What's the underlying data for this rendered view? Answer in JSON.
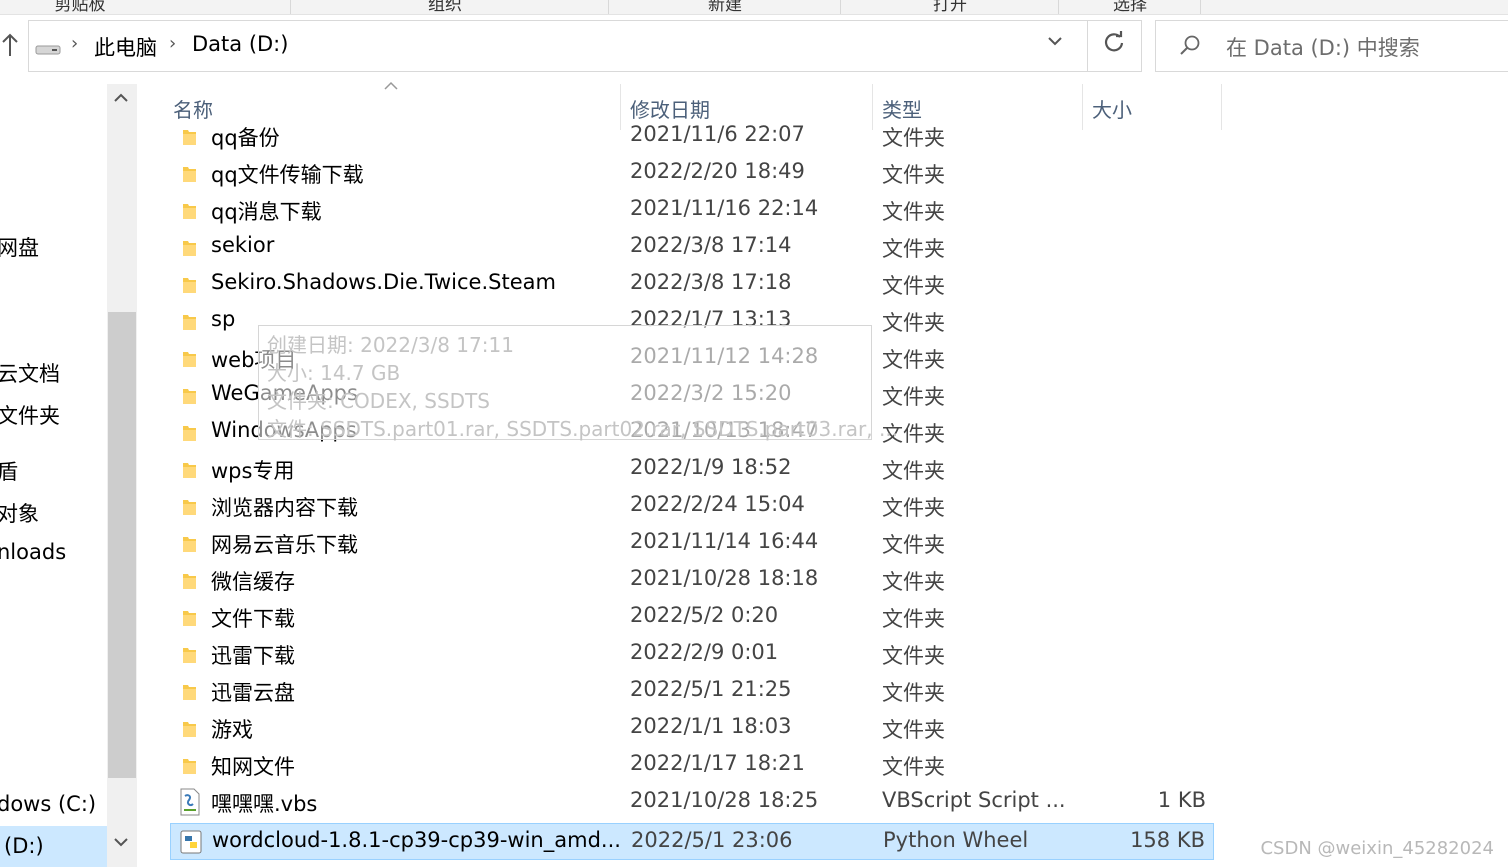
{
  "ribbon": {
    "groups": [
      "剪贴板",
      "组织",
      "新建",
      "打开",
      "选择"
    ]
  },
  "address": {
    "crumbs": [
      "此电脑",
      "Data (D:)"
    ],
    "search_placeholder": "在 Data (D:) 中搜索"
  },
  "nav": {
    "items": [
      "网盘",
      "云文档",
      "文件夹",
      "盾",
      "对象",
      "nloads",
      "dows (C:)",
      "(D:)"
    ]
  },
  "columns": {
    "name": "名称",
    "date": "修改日期",
    "type": "类型",
    "size": "大小"
  },
  "rows": [
    {
      "name": "qq备份",
      "date": "2021/11/6 22:07",
      "type": "文件夹",
      "size": ""
    },
    {
      "name": "qq文件传输下载",
      "date": "2022/2/20 18:49",
      "type": "文件夹",
      "size": ""
    },
    {
      "name": "qq消息下载",
      "date": "2021/11/16 22:14",
      "type": "文件夹",
      "size": ""
    },
    {
      "name": "sekior",
      "date": "2022/3/8 17:14",
      "type": "文件夹",
      "size": ""
    },
    {
      "name": "Sekiro.Shadows.Die.Twice.Steam",
      "date": "2022/3/8 17:18",
      "type": "文件夹",
      "size": ""
    },
    {
      "name": "sp",
      "date": "2022/1/7 13:13",
      "type": "文件夹",
      "size": ""
    },
    {
      "name": "web项目",
      "date": "2021/11/12 14:28",
      "type": "文件夹",
      "size": ""
    },
    {
      "name": "WeGameApps",
      "date": "2022/3/2 15:20",
      "type": "文件夹",
      "size": ""
    },
    {
      "name": "WindowsApps",
      "date": "2021/10/13 18:47",
      "type": "文件夹",
      "size": ""
    },
    {
      "name": "wps专用",
      "date": "2022/1/9 18:52",
      "type": "文件夹",
      "size": ""
    },
    {
      "name": "浏览器内容下载",
      "date": "2022/2/24 15:04",
      "type": "文件夹",
      "size": ""
    },
    {
      "name": "网易云音乐下载",
      "date": "2021/11/14 16:44",
      "type": "文件夹",
      "size": ""
    },
    {
      "name": "微信缓存",
      "date": "2021/10/28 18:18",
      "type": "文件夹",
      "size": ""
    },
    {
      "name": "文件下载",
      "date": "2022/5/2 0:20",
      "type": "文件夹",
      "size": ""
    },
    {
      "name": "迅雷下载",
      "date": "2022/2/9 0:01",
      "type": "文件夹",
      "size": ""
    },
    {
      "name": "迅雷云盘",
      "date": "2022/5/1 21:25",
      "type": "文件夹",
      "size": ""
    },
    {
      "name": "游戏",
      "date": "2022/1/1 18:03",
      "type": "文件夹",
      "size": ""
    },
    {
      "name": "知网文件",
      "date": "2022/1/17 18:21",
      "type": "文件夹",
      "size": ""
    },
    {
      "name": "嘿嘿嘿.vbs",
      "date": "2021/10/28 18:25",
      "type": "VBScript Script ...",
      "size": "1 KB"
    },
    {
      "name": "wordcloud-1.8.1-cp39-cp39-win_amd...",
      "date": "2022/5/1 23:06",
      "type": "Python Wheel",
      "size": "158 KB"
    }
  ],
  "tooltip": {
    "created": "创建日期: 2022/3/8 17:11",
    "size": "大小: 14.7 GB",
    "folders": "文件夹: CODEX, SSDTS",
    "files": "文件: SSDTS.part01.rar, SSDTS.part02.rar, SSDTS.part03.rar, ..."
  },
  "watermark": "CSDN @weixin_45282024",
  "colors": {
    "selection": "#cce8ff",
    "folder": "#f8c94a",
    "header_text": "#4c607a"
  }
}
